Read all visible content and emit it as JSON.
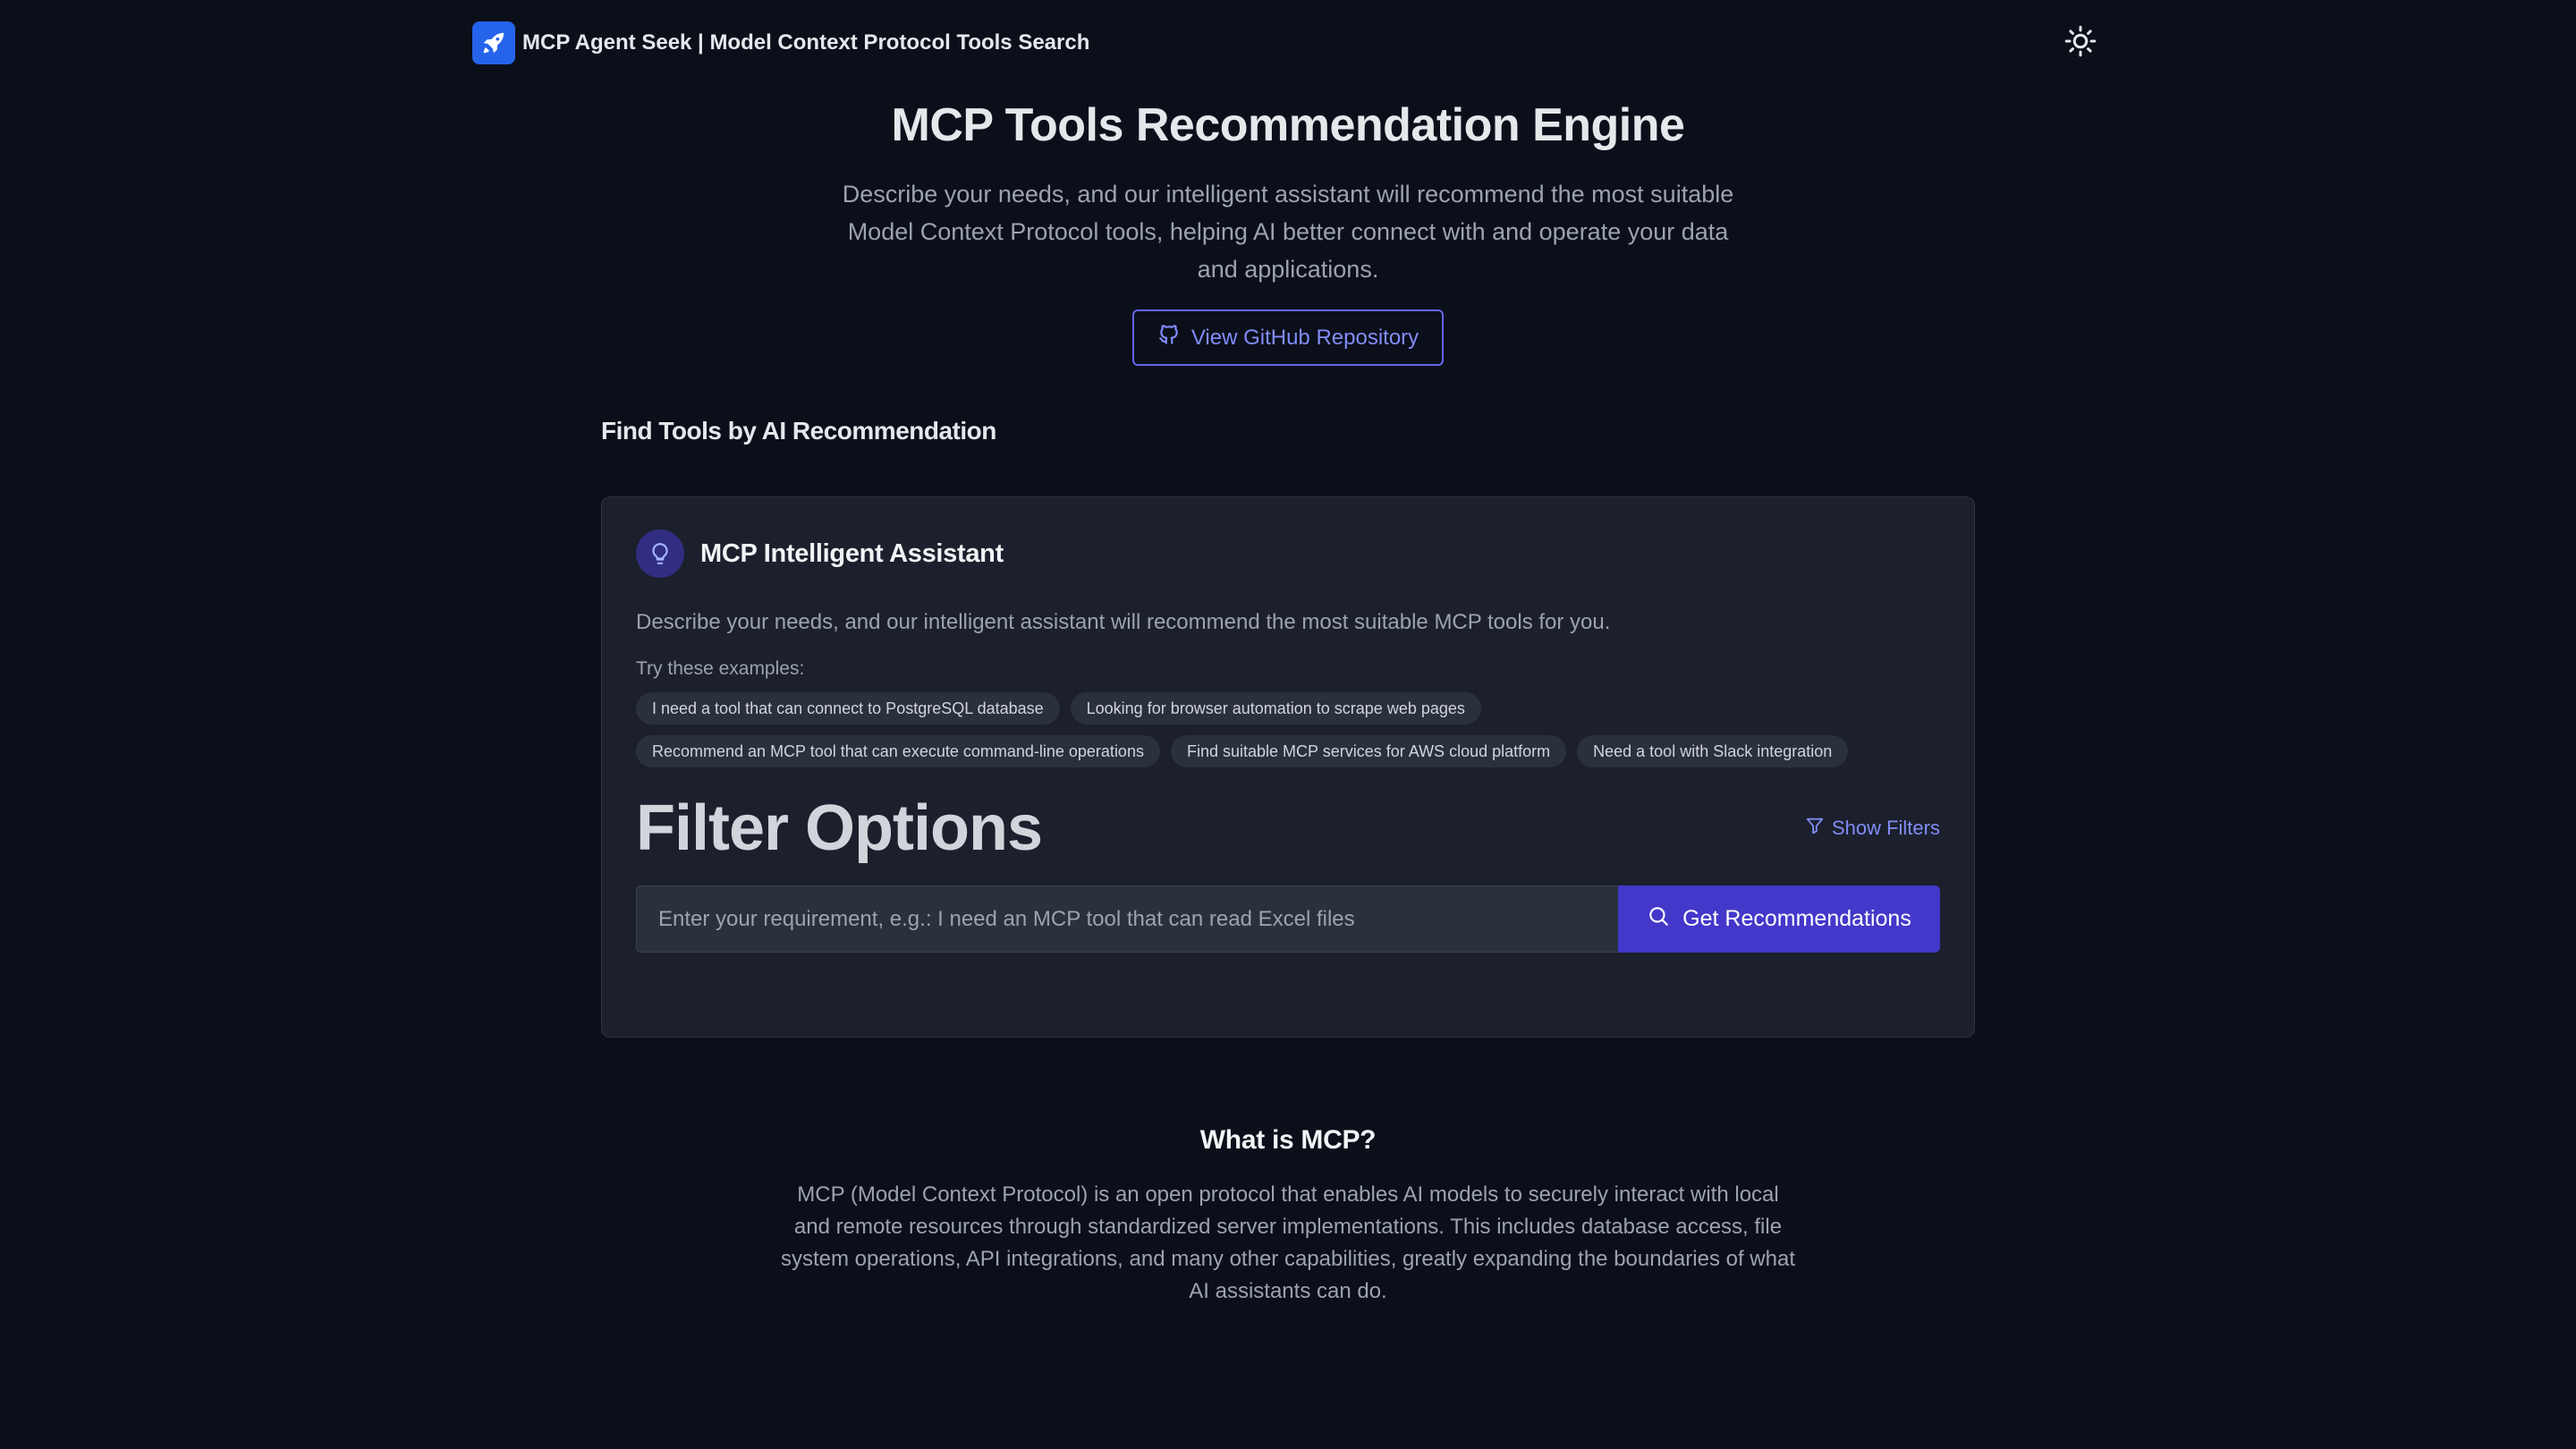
{
  "header": {
    "title": "MCP Agent Seek | Model Context Protocol Tools Search",
    "logo_icon": "rocket-icon",
    "theme_icon": "sun-icon"
  },
  "hero": {
    "title": "MCP Tools Recommendation Engine",
    "description": "Describe your needs, and our intelligent assistant will recommend the most suitable Model Context Protocol tools, helping AI better connect with and operate your data and applications.",
    "github_label": "View GitHub Repository"
  },
  "section": {
    "title": "Find Tools by AI Recommendation"
  },
  "assistant": {
    "title": "MCP Intelligent Assistant",
    "description": "Describe your needs, and our intelligent assistant will recommend the most suitable MCP tools for you.",
    "examples_label": "Try these examples:",
    "examples": [
      "I need a tool that can connect to PostgreSQL database",
      "Looking for browser automation to scrape web pages",
      "Recommend an MCP tool that can execute command-line operations",
      "Find suitable MCP services for AWS cloud platform",
      "Need a tool with Slack integration"
    ],
    "filter_title": "Filter Options",
    "show_filters_label": "Show Filters",
    "search_placeholder": "Enter your requirement, e.g.: I need an MCP tool that can read Excel files",
    "search_value": "",
    "submit_label": "Get Recommendations"
  },
  "about": {
    "title": "What is MCP?",
    "body": "MCP (Model Context Protocol) is an open protocol that enables AI models to securely interact with local and remote resources through standardized server implementations. This includes database access, file system operations, API integrations, and many other capabilities, greatly expanding the boundaries of what AI assistants can do."
  },
  "colors": {
    "background": "#0b0f1a",
    "card": "#1b202c",
    "accent": "#4338ca",
    "link": "#818cf8",
    "brand": "#2563eb"
  }
}
